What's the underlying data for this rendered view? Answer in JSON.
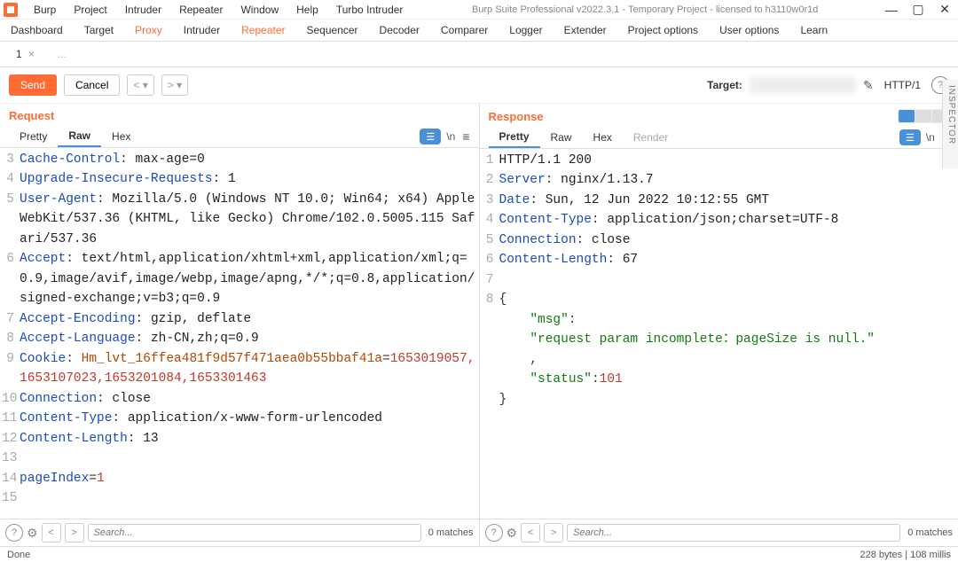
{
  "app": {
    "title": "Burp Suite Professional v2022.3.1 - Temporary Project - licensed to h3110w0r1d",
    "menus": [
      "Burp",
      "Project",
      "Intruder",
      "Repeater",
      "Window",
      "Help",
      "Turbo Intruder"
    ]
  },
  "main_tabs": [
    "Dashboard",
    "Target",
    "Proxy",
    "Intruder",
    "Repeater",
    "Sequencer",
    "Decoder",
    "Comparer",
    "Logger",
    "Extender",
    "Project options",
    "User options",
    "Learn"
  ],
  "active_main_tab": "Repeater",
  "subtabs": {
    "first": "1",
    "close": "×",
    "dots": "..."
  },
  "actions": {
    "send": "Send",
    "cancel": "Cancel",
    "target_label": "Target:",
    "http_ver": "HTTP/1"
  },
  "request": {
    "title": "Request",
    "view_tabs": [
      "Pretty",
      "Raw",
      "Hex"
    ],
    "active_view": "Raw",
    "lines": [
      {
        "n": "3",
        "header": "Cache-Control",
        "val": "max-age=0"
      },
      {
        "n": "4",
        "header": "Upgrade-Insecure-Requests",
        "val": "1"
      },
      {
        "n": "5",
        "header": "User-Agent",
        "val": "Mozilla/5.0 (Windows NT 10.0; Win64; x64) AppleWebKit/537.36 (KHTML, like Gecko) Chrome/102.0.5005.115 Safari/537.36"
      },
      {
        "n": "6",
        "header": "Accept",
        "val": "text/html,application/xhtml+xml,application/xml;q=0.9,image/avif,image/webp,image/apng,*/*;q=0.8,application/signed-exchange;v=b3;q=0.9"
      },
      {
        "n": "7",
        "header": "Accept-Encoding",
        "val": "gzip, deflate"
      },
      {
        "n": "8",
        "header": "Accept-Language",
        "val": "zh-CN,zh;q=0.9"
      },
      {
        "n": "9",
        "header": "Cookie",
        "cookie_name": "Hm_lvt_16ffea481f9d57f471aea0b55bbaf41a",
        "cookie_val": "1653019057,1653107023,1653201084,1653301463"
      },
      {
        "n": "10",
        "header": "Connection",
        "val": "close"
      },
      {
        "n": "11",
        "header": "Content-Type",
        "val": "application/x-www-form-urlencoded"
      },
      {
        "n": "12",
        "header": "Content-Length",
        "val": "13"
      },
      {
        "n": "13",
        "blank": true
      },
      {
        "n": "14",
        "param": "pageIndex",
        "pval": "1"
      },
      {
        "n": "15",
        "blank": true
      }
    ],
    "search_placeholder": "Search...",
    "matches": "0 matches"
  },
  "response": {
    "title": "Response",
    "view_tabs": [
      "Pretty",
      "Raw",
      "Hex",
      "Render"
    ],
    "active_view": "Pretty",
    "lines": [
      {
        "n": "1",
        "proto": "HTTP/1.1 200"
      },
      {
        "n": "2",
        "header": "Server",
        "val": "nginx/1.13.7"
      },
      {
        "n": "3",
        "header": "Date",
        "val": "Sun, 12 Jun 2022 10:12:55 GMT"
      },
      {
        "n": "4",
        "header": "Content-Type",
        "val": "application/json;charset=UTF-8"
      },
      {
        "n": "5",
        "header": "Connection",
        "val": "close"
      },
      {
        "n": "6",
        "header": "Content-Length",
        "val": "67"
      },
      {
        "n": "7",
        "blank": true
      }
    ],
    "json_body": {
      "start_line": "8",
      "msg_key": "\"msg\"",
      "msg_val": "\"request param incomplete：pageSize is null.\"",
      "status_key": "\"status\"",
      "status_val": "101"
    },
    "search_placeholder": "Search...",
    "matches": "0 matches"
  },
  "status": {
    "left": "Done",
    "right": "228 bytes | 108 millis"
  },
  "inspector": "INSPECTOR"
}
